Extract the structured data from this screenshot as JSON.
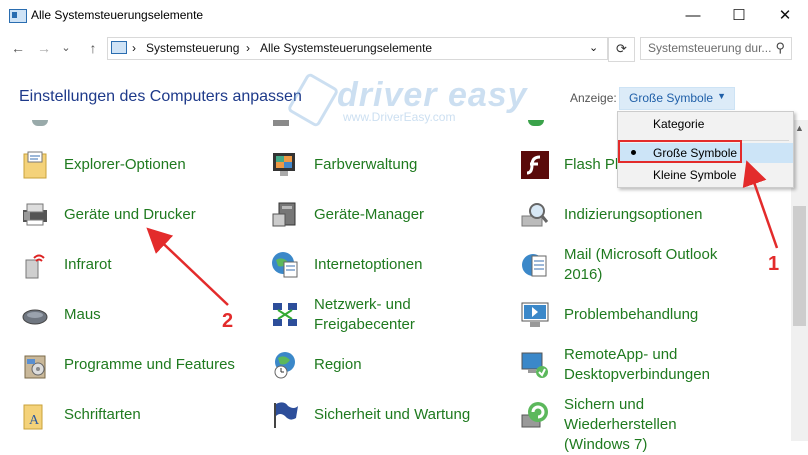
{
  "window": {
    "title": "Alle Systemsteuerungselemente",
    "minimize_symbol": "—",
    "maximize_symbol": "☐",
    "close_symbol": "✕"
  },
  "nav": {
    "back_symbol": "←",
    "forward_symbol": "→",
    "recent_symbol": "⌄",
    "up_symbol": "↑",
    "breadcrumb": [
      "Systemsteuerung",
      "Alle Systemsteuerungselemente"
    ],
    "separator": "›",
    "dropdown_symbol": "⌄",
    "refresh_symbol": "⟳",
    "search_placeholder": "Systemsteuerung dur...",
    "search_symbol": "⚲"
  },
  "heading": "Einstellungen des Computers anpassen",
  "watermark": {
    "text": "driver easy",
    "url": "www.DriverEasy.com"
  },
  "view": {
    "label": "Anzeige:",
    "selected": "Große Symbole",
    "arrow": "▼",
    "options": [
      "Kategorie",
      "Große Symbole",
      "Kleine Symbole"
    ]
  },
  "items": {
    "col1": [
      "Explorer-Optionen",
      "Geräte und Drucker",
      "Infrarot",
      "Maus",
      "Programme und Features",
      "Schriftarten"
    ],
    "col2": [
      "Farbverwaltung",
      "Geräte-Manager",
      "Internetoptionen",
      "Netzwerk- und",
      "Freigabecenter",
      "Region",
      "Sicherheit und Wartung"
    ],
    "col3": [
      "Flash Pl",
      "Indizierungsoptionen",
      "Mail (Microsoft Outlook",
      "2016)",
      "Problembehandlung",
      "RemoteApp- und",
      "Desktopverbindungen",
      "Sichern und",
      "Wiederherstellen",
      "(Windows 7)"
    ]
  },
  "annotations": {
    "marker1": "1",
    "marker2": "2"
  },
  "colors": {
    "link_green": "#1f7a1f",
    "heading_blue": "#1e3a8a",
    "annotation_red": "#e32b2b"
  },
  "scroll": {
    "up_arrow": "▲"
  }
}
